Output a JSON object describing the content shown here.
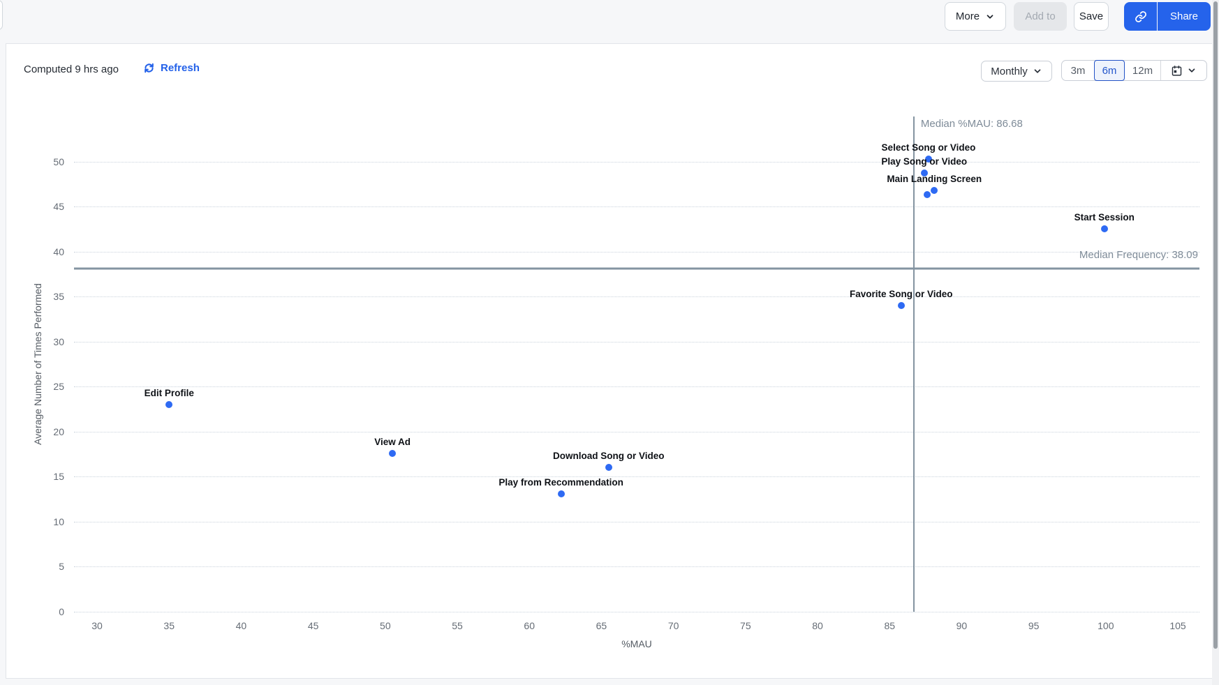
{
  "toolbar": {
    "more_label": "More",
    "add_to_label": "Add to",
    "save_label": "Save",
    "share_label": "Share"
  },
  "header": {
    "computed_text": "Computed 9 hrs ago",
    "refresh_label": "Refresh",
    "granularity_selected": "Monthly",
    "range_options": [
      "3m",
      "6m",
      "12m"
    ],
    "range_selected": "6m"
  },
  "chart_data": {
    "type": "scatter",
    "xlabel": "%MAU",
    "ylabel": "Average Number of Times Performed",
    "xlim": [
      28.4,
      106.5
    ],
    "ylim": [
      0,
      55
    ],
    "x_ticks": [
      30,
      35,
      40,
      45,
      50,
      55,
      60,
      65,
      70,
      75,
      80,
      85,
      90,
      95,
      100,
      105
    ],
    "y_ticks": [
      0,
      5,
      10,
      15,
      20,
      25,
      30,
      35,
      40,
      45,
      50
    ],
    "grid": "horizontal-dotted",
    "median_x": {
      "label": "Median %MAU: 86.68",
      "value": 86.68
    },
    "median_y": {
      "label": "Median Frequency: 38.09",
      "value": 38.09
    },
    "points": [
      {
        "label": "Select Song or Video",
        "x": 87.7,
        "y": 50.3
      },
      {
        "label": "Play Song or Video",
        "x": 87.4,
        "y": 48.7
      },
      {
        "label": "Main Landing Screen",
        "x": 88.1,
        "y": 46.8
      },
      {
        "label": "",
        "x": 87.6,
        "y": 46.3
      },
      {
        "label": "Start Session",
        "x": 99.9,
        "y": 42.5
      },
      {
        "label": "Favorite Song or Video",
        "x": 85.8,
        "y": 34.0
      },
      {
        "label": "Edit Profile",
        "x": 35.0,
        "y": 23.0
      },
      {
        "label": "View Ad",
        "x": 50.5,
        "y": 17.6
      },
      {
        "label": "Download Song or Video",
        "x": 65.5,
        "y": 16.0
      },
      {
        "label": "Play from Recommendation",
        "x": 62.2,
        "y": 13.1
      }
    ],
    "colors": {
      "point": "#2e6af3",
      "median_line": "#8494a1",
      "accent_blue": "#2563eb"
    }
  }
}
